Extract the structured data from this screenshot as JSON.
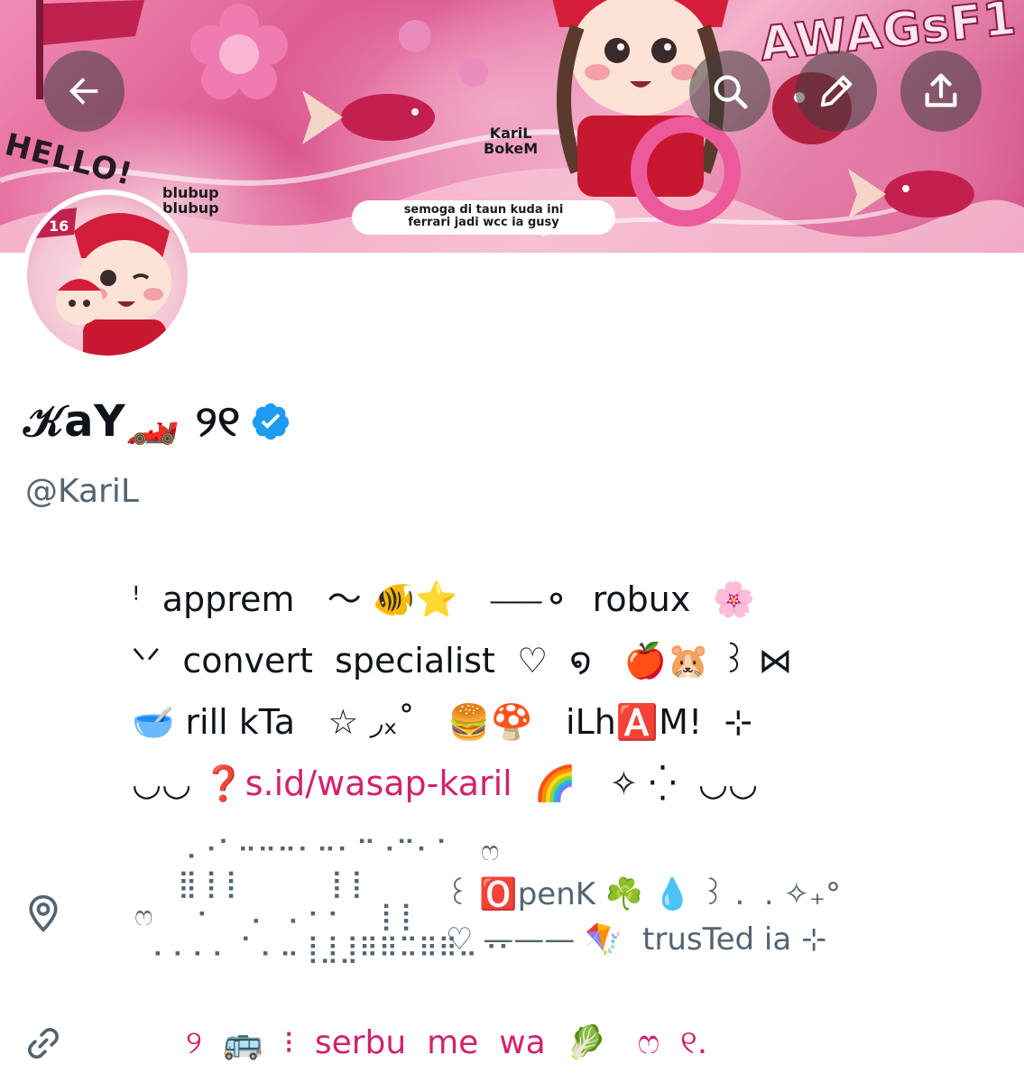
{
  "header": {
    "banner": {
      "hello_text": "HELLO!",
      "bubble_text": "blubup\nblubup",
      "character_caption": "KariL\nBokeM",
      "wags_text": "AWAGsF1",
      "caption_text": "semoga di taun kuda ini\nferrari jadi wcc ia gusy"
    },
    "buttons": [
      {
        "id": "back",
        "icon": "arrow-left-icon"
      },
      {
        "id": "search",
        "icon": "search-icon"
      },
      {
        "id": "edit",
        "icon": "pencil-icon"
      },
      {
        "id": "share",
        "icon": "upload-icon"
      }
    ]
  },
  "profile": {
    "display_name": "𝒦aY🏎️ ୨୧",
    "verified": true,
    "handle": "@KariL",
    "accent_color": "#d2226d",
    "verified_color": "#1d9bf0",
    "avatar_badge": "16"
  },
  "bio": {
    "line1": "ꜝ  apprem   〜 🐠⭐   ⎯⎯⎯⚬  robux  🌸",
    "line2": "ᐠᐟ  convert  specialist  ♡  ໑   🍎🐹 ꒱ ⋈",
    "line3": "🥣 rill kTa   ☆ ◞ₓ˚   🍔🍄   iLh🅰️M!  ⊹",
    "line4_prefix": "◡◡ ❓",
    "line4_link": "s.id/wasap-karil",
    "line4_suffix": "  🌈   ✧ ⁛  ◡◡"
  },
  "location": {
    "icon": "location-pin-icon",
    "art": "       ⠠⠐⠁⠒⠒⠒⠂⠒⠂⠉⠐⠉⠂⠁   ෆ\n       ⣿⢸⢸          ⢸⢸\n  ෆ     ⠂    ⠄  ⠄⠂⠂   ⢸⢸\n    ⠄⠄⠄⠄ ⠁⠄⠤⢸⣸⣸⠿⠿⠭⠿⠿⠤⠐⠂",
    "text_line1": "꒰ 🅾️penK ☘️ 💧 ꒱ .  . ✧₊°",
    "text_line2": "♡ ——— 🪁  trusTed ia ⊹"
  },
  "link": {
    "icon": "link-icon",
    "text": "୨  🚌  ⁝  serbu  me  wa  🥬   ෆ  ୧."
  }
}
